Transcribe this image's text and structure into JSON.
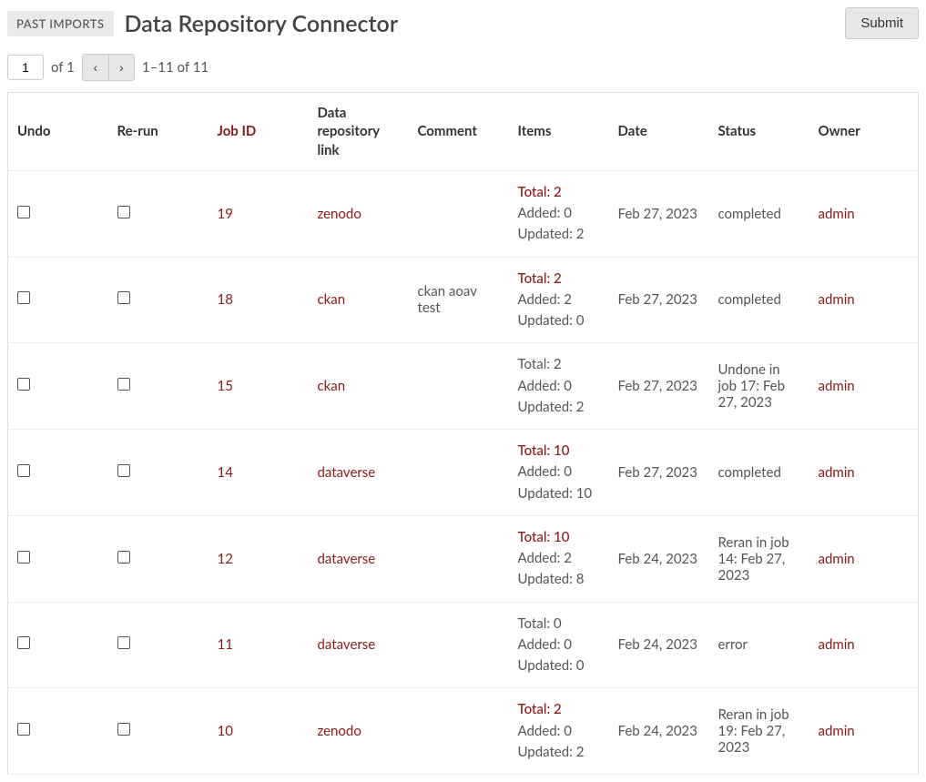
{
  "header": {
    "badge": "PAST IMPORTS",
    "title": "Data Repository Connector",
    "submit_label": "Submit"
  },
  "pagination": {
    "page_value": "1",
    "of_label": "of 1",
    "range_label": "1–11 of 11"
  },
  "table": {
    "headers": {
      "undo": "Undo",
      "rerun": "Re-run",
      "jobid": "Job ID",
      "repo": "Data repository link",
      "comment": "Comment",
      "items": "Items",
      "date": "Date",
      "status": "Status",
      "owner": "Owner"
    },
    "rows": [
      {
        "jobid": "19",
        "repo": "zenodo",
        "comment": "",
        "items_total": "Total: 2",
        "items_total_linked": true,
        "items_added": "Added: 0",
        "items_updated": "Updated: 2",
        "date": "Feb 27, 2023",
        "status": "completed",
        "owner": "admin"
      },
      {
        "jobid": "18",
        "repo": "ckan",
        "comment": "ckan aoav test",
        "items_total": "Total: 2",
        "items_total_linked": true,
        "items_added": "Added: 2",
        "items_updated": "Updated: 0",
        "date": "Feb 27, 2023",
        "status": "completed",
        "owner": "admin"
      },
      {
        "jobid": "15",
        "repo": "ckan",
        "comment": "",
        "items_total": "Total: 2",
        "items_total_linked": false,
        "items_added": "Added: 0",
        "items_updated": "Updated: 2",
        "date": "Feb 27, 2023",
        "status": "Undone in job 17: Feb 27, 2023",
        "owner": "admin"
      },
      {
        "jobid": "14",
        "repo": "dataverse",
        "comment": "",
        "items_total": "Total: 10",
        "items_total_linked": true,
        "items_added": "Added: 0",
        "items_updated": "Updated: 10",
        "date": "Feb 27, 2023",
        "status": "completed",
        "owner": "admin"
      },
      {
        "jobid": "12",
        "repo": "dataverse",
        "comment": "",
        "items_total": "Total: 10",
        "items_total_linked": true,
        "items_added": "Added: 2",
        "items_updated": "Updated: 8",
        "date": "Feb 24, 2023",
        "status": "Reran in job 14: Feb 27, 2023",
        "owner": "admin"
      },
      {
        "jobid": "11",
        "repo": "dataverse",
        "comment": "",
        "items_total": "Total: 0",
        "items_total_linked": false,
        "items_added": "Added: 0",
        "items_updated": "Updated: 0",
        "date": "Feb 24, 2023",
        "status": "error",
        "owner": "admin"
      },
      {
        "jobid": "10",
        "repo": "zenodo",
        "comment": "",
        "items_total": "Total: 2",
        "items_total_linked": true,
        "items_added": "Added: 0",
        "items_updated": "Updated: 2",
        "date": "Feb 24, 2023",
        "status": "Reran in job 19: Feb 27, 2023",
        "owner": "admin"
      }
    ]
  }
}
